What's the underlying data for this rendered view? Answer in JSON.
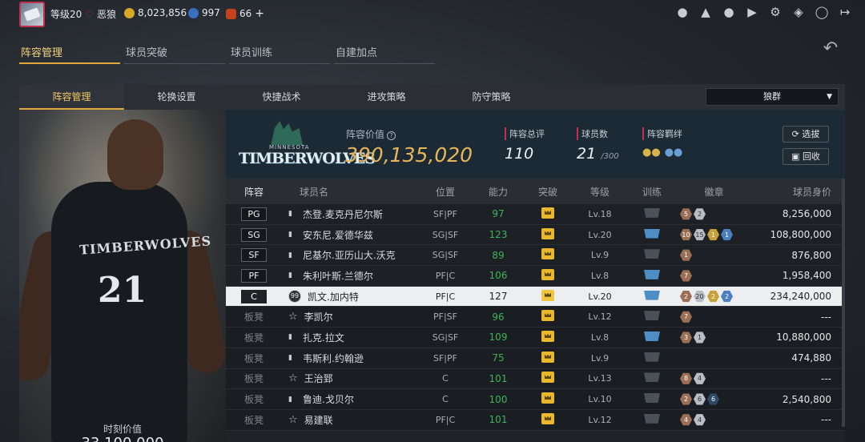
{
  "topbar": {
    "level": "等级20",
    "title": "恶狼",
    "gold": "8,023,856",
    "star_points": "997",
    "gems": "66",
    "plus": "+"
  },
  "main_tabs": [
    "阵容管理",
    "球员突破",
    "球员训练",
    "自建加点"
  ],
  "sub_tabs": [
    "阵容管理",
    "轮换设置",
    "快捷战术",
    "进攻策略",
    "防守策略"
  ],
  "dropdown": {
    "selected": "狼群"
  },
  "portrait": {
    "jersey_name": "TIMBERWOLVES",
    "jersey_number": "21",
    "time_label": "时刻价值",
    "time_value": "33,100,000"
  },
  "team": {
    "logo_text": "TIMBERWOLVES",
    "logo_small": "MINNESOTA",
    "value_label": "阵容价值",
    "value": "390,135,020",
    "rating_label": "阵容总评",
    "rating": "110",
    "count_label": "球员数",
    "count": "21",
    "count_max": "/300",
    "bond_label": "阵容羁绊",
    "btn_pick": "选拔",
    "btn_recycle": "回收"
  },
  "table_headers": [
    "阵容",
    "球员名",
    "位置",
    "能力",
    "突破",
    "等级",
    "训练",
    "徽章",
    "球员身价"
  ],
  "rows": [
    {
      "slot": "PG",
      "name": "杰登.麦克丹尼尔斯",
      "pos": "SF|PF",
      "ability": "97",
      "level": "Lv.18",
      "salary": "8,256,000",
      "train": "gray",
      "badges": [
        [
          "bronze",
          "5"
        ],
        [
          "silver",
          "2"
        ]
      ]
    },
    {
      "slot": "SG",
      "name": "安东尼.爱德华兹",
      "pos": "SG|SF",
      "ability": "123",
      "level": "Lv.20",
      "salary": "108,800,000",
      "train": "blue",
      "badges": [
        [
          "bronze",
          "10"
        ],
        [
          "silver",
          "15"
        ],
        [
          "gold",
          "1"
        ],
        [
          "blue",
          "1"
        ]
      ]
    },
    {
      "slot": "SF",
      "name": "尼基尔.亚历山大.沃克",
      "pos": "SG|SF",
      "ability": "89",
      "level": "Lv.9",
      "salary": "876,800",
      "train": "gray",
      "badges": [
        [
          "bronze",
          "1"
        ]
      ]
    },
    {
      "slot": "PF",
      "name": "朱利叶斯.兰德尔",
      "pos": "PF|C",
      "ability": "106",
      "level": "Lv.8",
      "salary": "1,958,400",
      "train": "blue",
      "badges": [
        [
          "bronze",
          "7"
        ]
      ]
    },
    {
      "slot": "C",
      "name": "凯文.加内特",
      "pos": "PF|C",
      "ability": "127",
      "level": "Lv.20",
      "salary": "234,240,000",
      "train": "blue",
      "badges": [
        [
          "bronze",
          "2"
        ],
        [
          "silver",
          "20"
        ],
        [
          "gold",
          "2"
        ],
        [
          "blue",
          "2"
        ]
      ],
      "selected": true,
      "icon": "99"
    },
    {
      "slot": "板凳",
      "name": "李凯尔",
      "pos": "PF|SF",
      "ability": "96",
      "level": "Lv.12",
      "salary": "---",
      "train": "gray",
      "badges": [
        [
          "bronze",
          "7"
        ]
      ],
      "star": true
    },
    {
      "slot": "板凳",
      "name": "扎克.拉文",
      "pos": "SG|SF",
      "ability": "109",
      "level": "Lv.8",
      "salary": "10,880,000",
      "train": "blue",
      "badges": [
        [
          "bronze",
          "3"
        ],
        [
          "silver",
          "1"
        ]
      ]
    },
    {
      "slot": "板凳",
      "name": "韦斯利.约翰逊",
      "pos": "SF|PF",
      "ability": "75",
      "level": "Lv.9",
      "salary": "474,880",
      "train": "gray",
      "badges": []
    },
    {
      "slot": "板凳",
      "name": "王治郅",
      "pos": "C",
      "ability": "101",
      "level": "Lv.13",
      "salary": "---",
      "train": "gray",
      "badges": [
        [
          "bronze",
          "8"
        ],
        [
          "silver",
          "4"
        ]
      ],
      "star": true
    },
    {
      "slot": "板凳",
      "name": "鲁迪.戈贝尔",
      "pos": "C",
      "ability": "100",
      "level": "Lv.10",
      "salary": "2,540,800",
      "train": "gray",
      "badges": [
        [
          "bronze",
          "2"
        ],
        [
          "silver",
          "6"
        ],
        [
          "dark",
          "6"
        ]
      ]
    },
    {
      "slot": "板凳",
      "name": "易建联",
      "pos": "PF|C",
      "ability": "101",
      "level": "Lv.12",
      "salary": "---",
      "train": "gray",
      "badges": [
        [
          "bronze",
          "4"
        ],
        [
          "silver",
          "4"
        ]
      ],
      "star": true
    }
  ],
  "icons": [
    "profile-icon",
    "bell-icon",
    "friends-icon",
    "video-icon",
    "gear-icon",
    "shield-icon",
    "headset-icon",
    "logout-icon"
  ],
  "colors": {
    "accent": "#e0a93b",
    "value": "#e8b558",
    "green": "#3fb25a",
    "highlight": "#c0314f"
  }
}
